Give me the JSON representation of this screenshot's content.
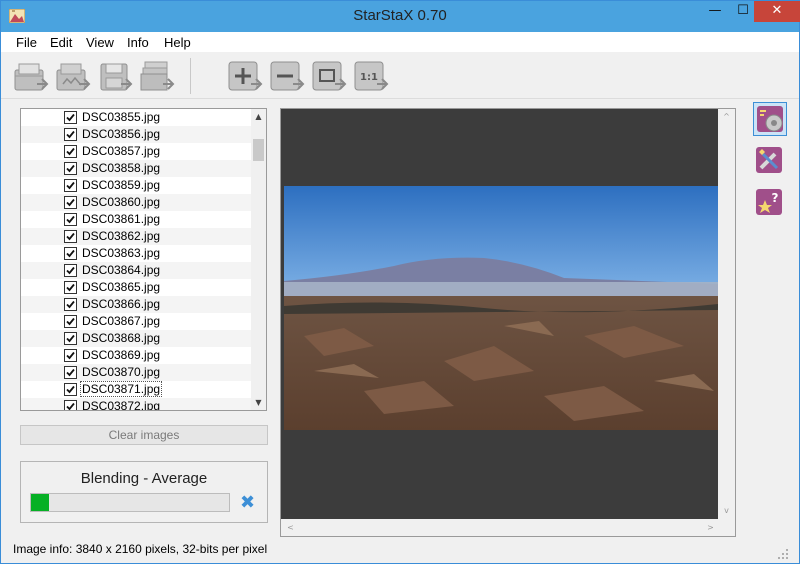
{
  "window": {
    "title": "StarStaX 0.70",
    "minimize_glyph": "—",
    "maximize_glyph": "☐",
    "close_glyph": "✕"
  },
  "menu": {
    "items": [
      {
        "label": "File"
      },
      {
        "label": "Edit"
      },
      {
        "label": "View"
      },
      {
        "label": "Info"
      },
      {
        "label": "Help"
      }
    ]
  },
  "toolbar": {
    "buttons": [
      {
        "icon": "open-images-icon"
      },
      {
        "icon": "open-dark-frames-icon"
      },
      {
        "icon": "save-image-icon"
      },
      {
        "icon": "start-processing-icon"
      },
      {
        "icon": "zoom-in-icon",
        "glyph": "+"
      },
      {
        "icon": "zoom-out-icon",
        "glyph": "−"
      },
      {
        "icon": "fit-to-window-icon",
        "glyph": "□"
      },
      {
        "icon": "actual-size-icon",
        "glyph": "1:1"
      }
    ]
  },
  "file_list": {
    "files": [
      "DSC03855.jpg",
      "DSC03856.jpg",
      "DSC03857.jpg",
      "DSC03858.jpg",
      "DSC03859.jpg",
      "DSC03860.jpg",
      "DSC03861.jpg",
      "DSC03862.jpg",
      "DSC03863.jpg",
      "DSC03864.jpg",
      "DSC03865.jpg",
      "DSC03866.jpg",
      "DSC03867.jpg",
      "DSC03868.jpg",
      "DSC03869.jpg",
      "DSC03870.jpg",
      "DSC03871.jpg",
      "DSC03872.jpg"
    ],
    "selected_index": 16,
    "all_checked": true,
    "scroll_up_glyph": "▲",
    "scroll_down_glyph": "▼"
  },
  "clear_button": {
    "label": "Clear images"
  },
  "progress": {
    "label": "Blending - Average",
    "fraction": 0.09,
    "fill_color": "#06b025",
    "cancel_glyph": "✖"
  },
  "viewer": {
    "hscroll_left_glyph": "<",
    "hscroll_right_glyph": ">",
    "vscroll_up_glyph": "^",
    "vscroll_down_glyph": "v"
  },
  "side_panel": {
    "buttons": [
      {
        "icon": "blending-settings-icon",
        "active": true
      },
      {
        "icon": "preferences-tools-icon",
        "active": false
      },
      {
        "icon": "help-star-icon",
        "active": false
      }
    ]
  },
  "status": {
    "text": "Image info: 3840 x 2160 pixels, 32-bits per pixel"
  },
  "colors": {
    "titlebar": "#4aa3df",
    "close_button": "#c7453a",
    "accent": "#3d8fd6",
    "viewer_background": "#3c3c3c"
  }
}
